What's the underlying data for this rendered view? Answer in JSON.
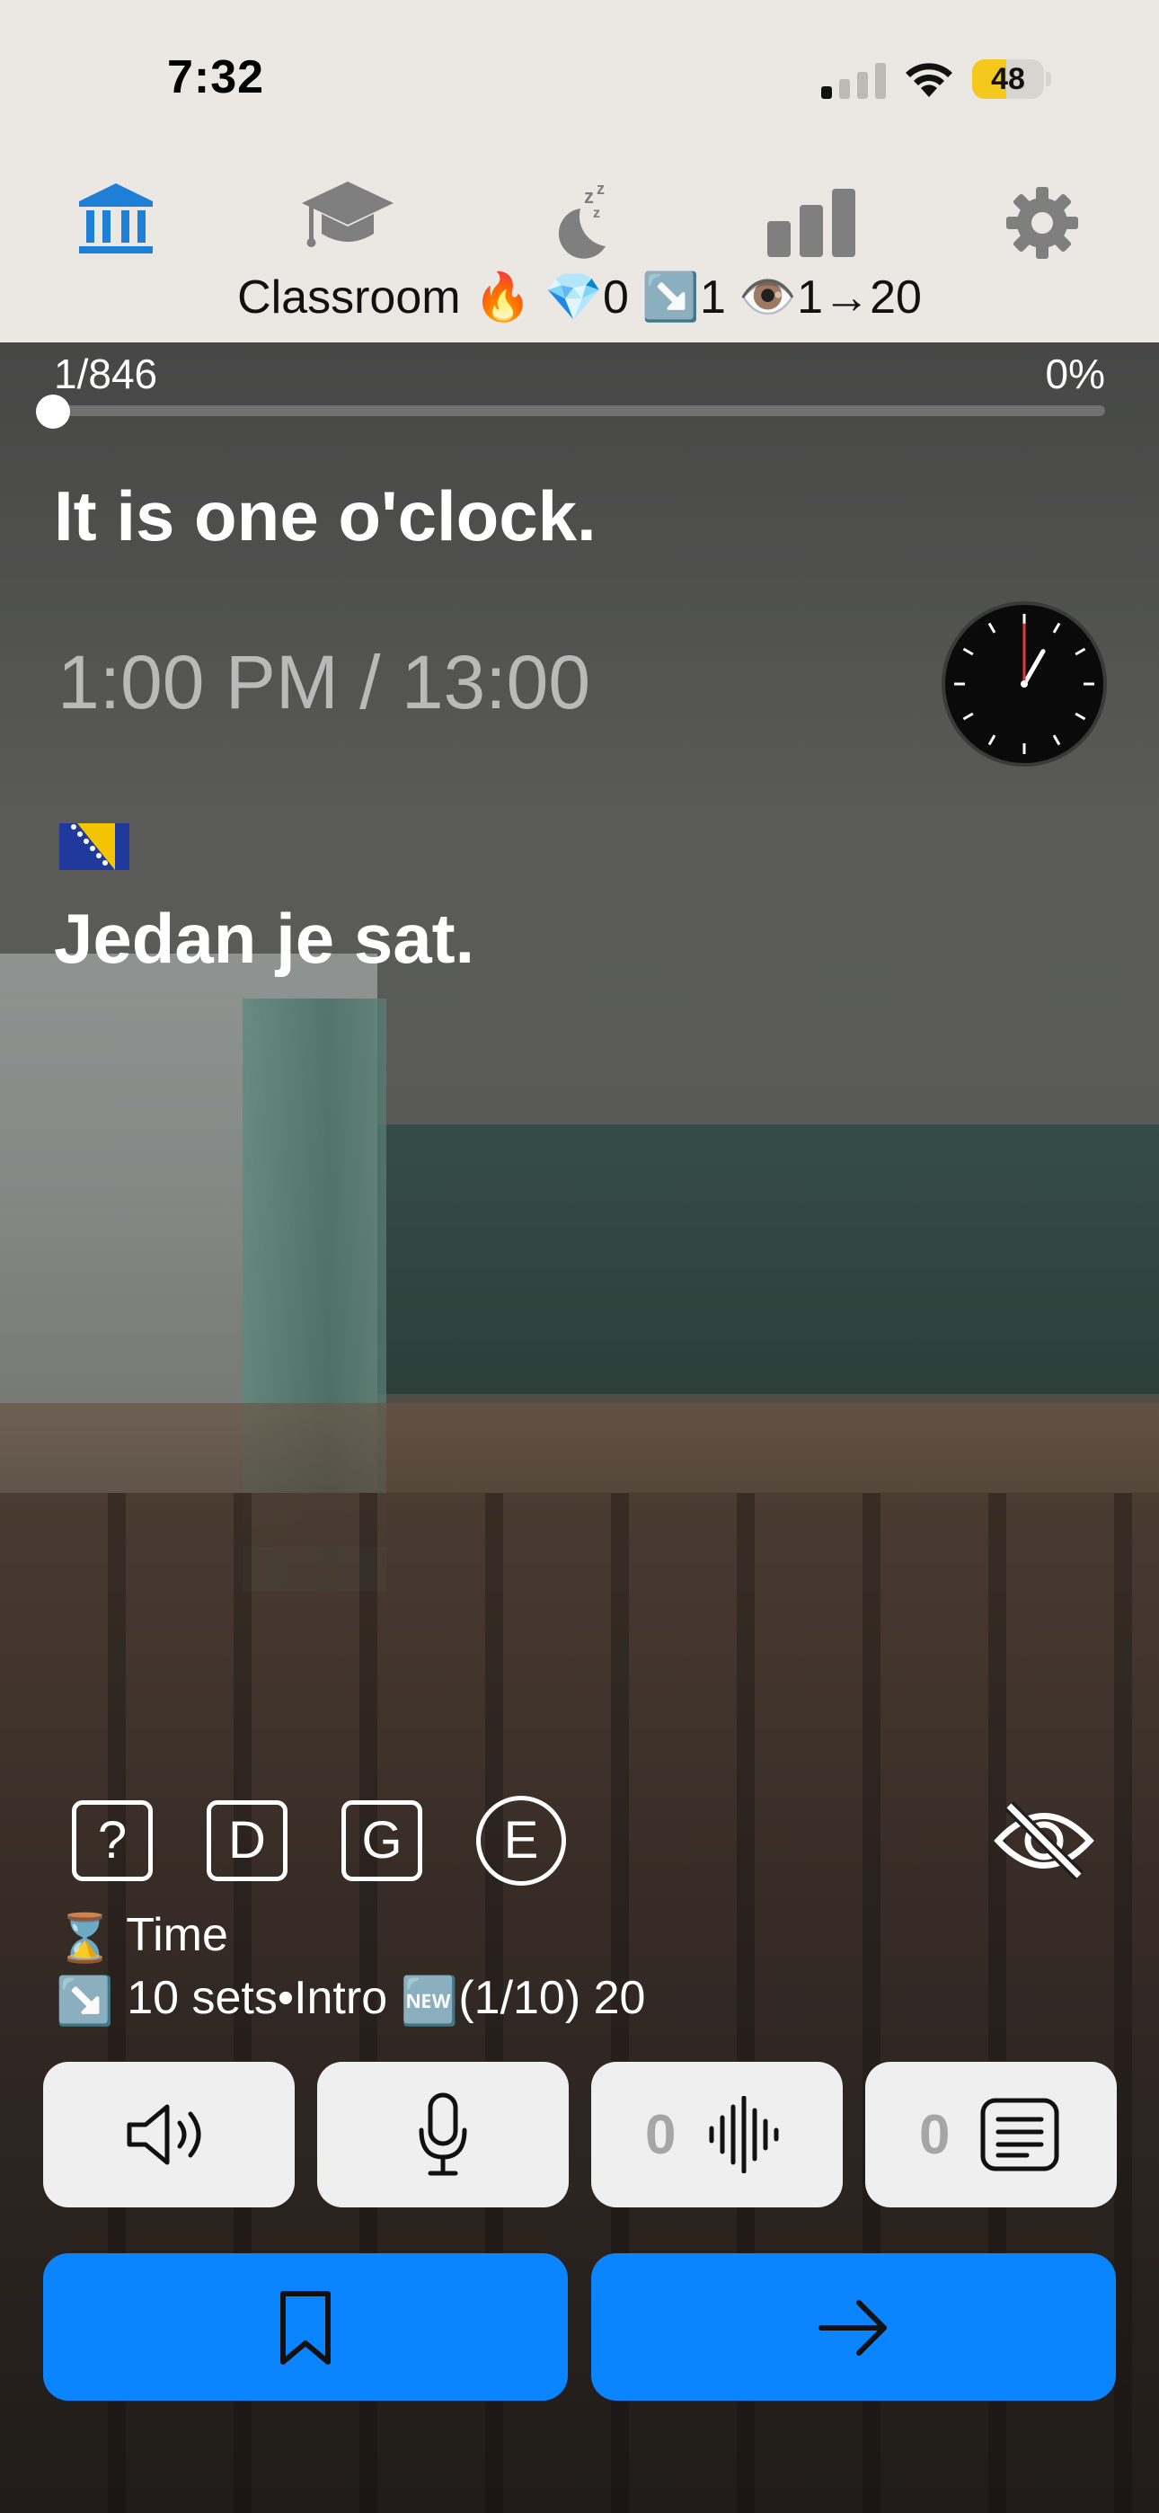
{
  "status_bar": {
    "time": "7:32",
    "battery_percent": 48,
    "battery_label": "48"
  },
  "nav": {
    "tabs": [
      {
        "icon": "bank-icon",
        "active": true
      },
      {
        "icon": "graduation-cap-icon",
        "active": false
      },
      {
        "icon": "sleep-moon-icon",
        "active": false
      },
      {
        "icon": "bar-chart-icon",
        "active": false
      },
      {
        "icon": "gear-icon",
        "active": false
      }
    ],
    "title": "Classroom 🔥 💎0 ↘️1 👁️1→20",
    "accent_color": "#1e7fd6",
    "inactive_color": "#7f7f7f"
  },
  "progress": {
    "position_label": "1/846",
    "percent_label": "0%",
    "fraction": 0.0
  },
  "card": {
    "sentence_en": "It is one o'clock.",
    "time_value": "1:00 PM / 13:00",
    "clock_hour": 1,
    "clock_minute": 0,
    "language_flag": "🇧🇦",
    "sentence_translation": "Jedan je sat."
  },
  "tools": {
    "help_label": "?",
    "d_label": "D",
    "g_label": "G",
    "e_label": "E"
  },
  "meta": {
    "topic_icon": "⌛",
    "topic": "Time",
    "set_icon": "↘️",
    "set_info": "10 sets•Intro",
    "new_badge": "🆕",
    "set_progress": "(1/10) 20"
  },
  "controls": {
    "listen_icon": "speaker-icon",
    "record_icon": "microphone-icon",
    "recordings_count": "0",
    "transcripts_count": "0"
  },
  "actions": {
    "bookmark_icon": "bookmark-icon",
    "next_icon": "arrow-right-icon",
    "primary_color": "#0a84ff"
  }
}
